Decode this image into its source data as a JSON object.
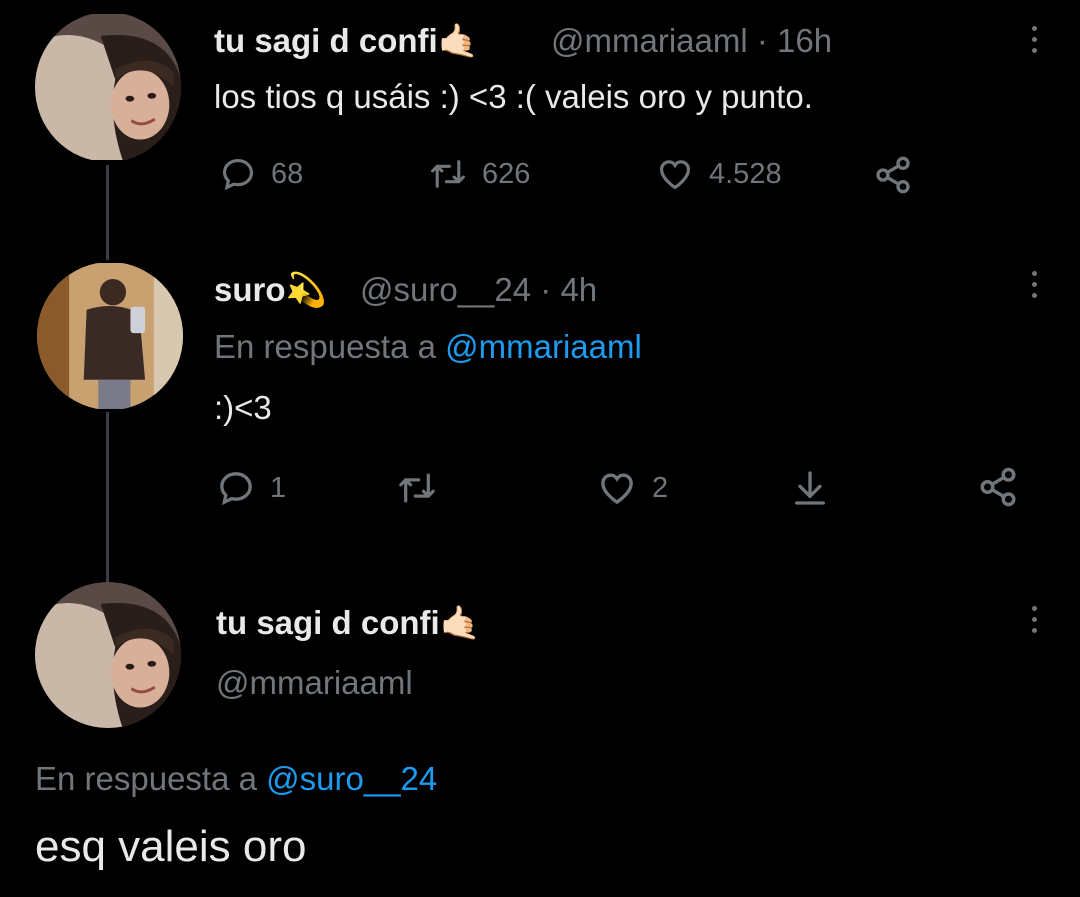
{
  "tweet1": {
    "display_name": "tu sagi d confi",
    "name_emoji": "🤙🏻",
    "handle": "@mmariaaml",
    "separator": "·",
    "time": "16h",
    "text": "los tios q usáis  :) <3 :( valeis oro y punto.",
    "replies": "68",
    "retweets": "626",
    "likes": "4.528"
  },
  "tweet2": {
    "display_name": "suro",
    "name_emoji": "💫",
    "handle": "@suro__24",
    "separator": "·",
    "time": "4h",
    "reply_prefix": "En respuesta a ",
    "reply_to": "@mmariaaml",
    "text": ":)<3",
    "replies": "1",
    "retweets": "",
    "likes": "2"
  },
  "tweet3": {
    "display_name": "tu sagi d confi",
    "name_emoji": "🤙🏻",
    "handle": "@mmariaaml",
    "reply_prefix": "En respuesta a ",
    "reply_to": "@suro__24",
    "text": "esq valeis oro"
  },
  "icons": {
    "reply": "comment-bubble-icon",
    "retweet": "retweet-icon",
    "like": "heart-icon",
    "share": "share-nodes-icon",
    "download": "download-arrow-icon",
    "more": "more-vertical-icon"
  },
  "colors": {
    "background": "#000000",
    "text": "#e7e9ea",
    "muted": "#71767b",
    "link": "#1d9bf0"
  }
}
